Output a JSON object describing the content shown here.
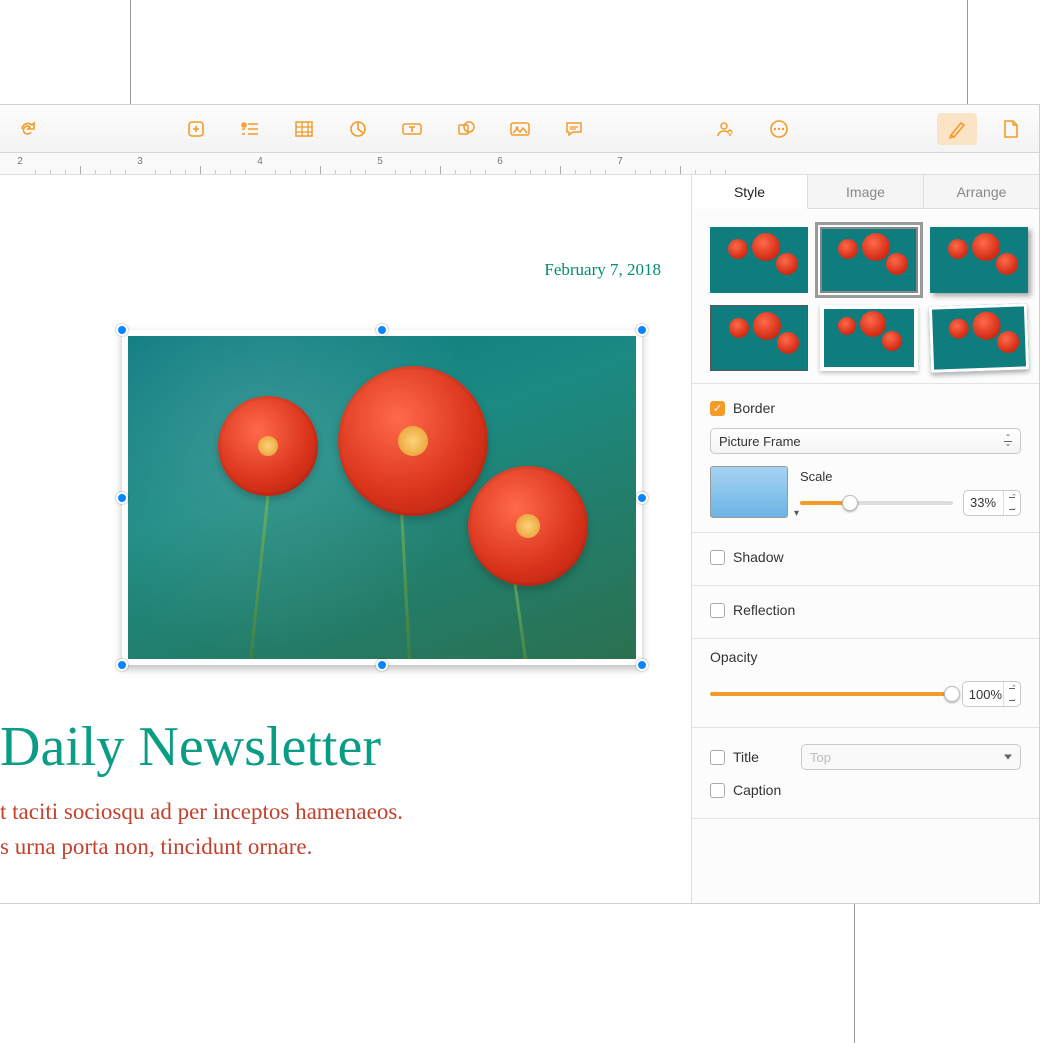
{
  "toolbar": {
    "icons": [
      "redo",
      "add",
      "insert-list",
      "table",
      "chart",
      "text-box",
      "shape",
      "media",
      "comment",
      "collaborate",
      "more",
      "format",
      "document"
    ]
  },
  "ruler": {
    "start": 2,
    "end": 7
  },
  "document": {
    "date": "February 7, 2018",
    "title": "Daily Newsletter",
    "body_line1": "t taciti sociosqu ad per inceptos hamenaeos.",
    "body_line2": "s urna porta non, tincidunt ornare."
  },
  "sidebar": {
    "tabs": {
      "style": "Style",
      "image": "Image",
      "arrange": "Arrange"
    },
    "active_tab": "style",
    "border": {
      "label": "Border",
      "checked": true,
      "type": "Picture Frame",
      "scale_label": "Scale",
      "scale_value": "33%",
      "scale_pct": 33
    },
    "shadow": {
      "label": "Shadow",
      "checked": false
    },
    "reflection": {
      "label": "Reflection",
      "checked": false
    },
    "opacity": {
      "label": "Opacity",
      "value": "100%",
      "pct": 100
    },
    "title": {
      "label": "Title",
      "checked": false,
      "position": "Top"
    },
    "caption": {
      "label": "Caption",
      "checked": false
    }
  }
}
